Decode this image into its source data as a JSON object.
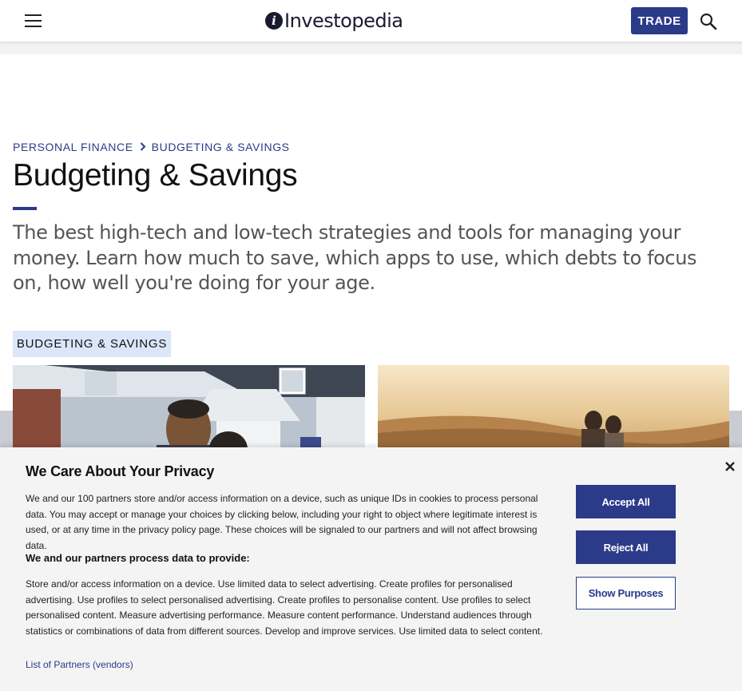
{
  "header": {
    "logo_text": "Investopedia",
    "trade_label": "TRADE",
    "menu_icon": "hamburger-menu-icon",
    "search_icon": "search-icon"
  },
  "breadcrumb": {
    "items": [
      "PERSONAL FINANCE",
      "BUDGETING & SAVINGS"
    ]
  },
  "page": {
    "title": "Budgeting & Savings",
    "intro": "The best high-tech and low-tech strategies and tools for managing your money. Learn how much to save, which apps to use, which debts to focus on, how well you're doing for your age.",
    "section_tag": "BUDGETING & SAVINGS"
  },
  "cards": [
    {
      "image": "family-in-front-of-house"
    },
    {
      "image": "couple-on-beach-at-sunset"
    }
  ],
  "privacy": {
    "title": "We Care About Your Privacy",
    "body": "We and our 100 partners store and/or access information on a device, such as unique IDs in cookies to process personal data. You may accept or manage your choices by clicking below, including your right to object where legitimate interest is used, or at any time in the privacy policy page. These choices will be signaled to our partners and will not affect browsing data.",
    "subheading": "We and our partners process data to provide:",
    "purposes": "Store and/or access information on a device. Use limited data to select advertising. Create profiles for personalised advertising. Use profiles to select personalised advertising. Create profiles to personalise content. Use profiles to select personalised content. Measure advertising performance. Measure content performance. Understand audiences through statistics or combinations of data from different sources. Develop and improve services. Use limited data to select content.",
    "partners_link": "List of Partners (vendors)",
    "accept_label": "Accept All",
    "reject_label": "Reject All",
    "purposes_label": "Show Purposes",
    "close_icon": "close-icon"
  },
  "colors": {
    "brand": "#2c3a8a",
    "tag_bg": "#dbe6f9",
    "banner_bg": "#f4f4f4"
  }
}
